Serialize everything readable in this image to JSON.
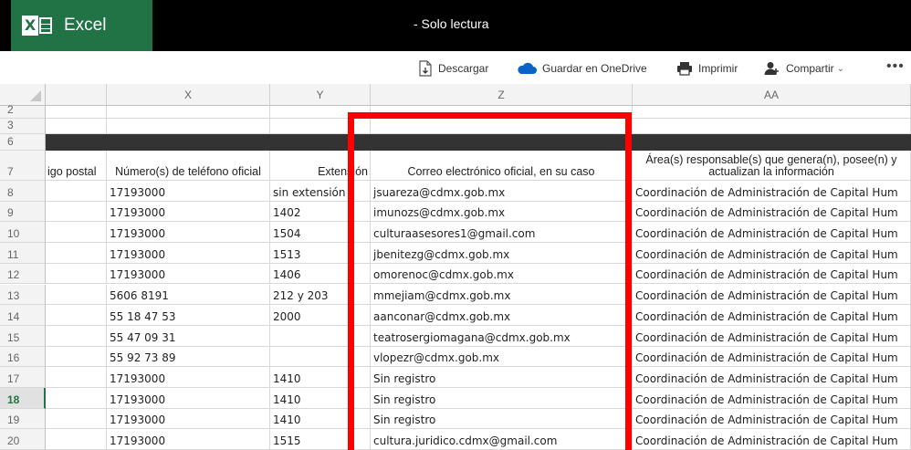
{
  "app": {
    "name": "Excel",
    "document_title": "-   Solo lectura"
  },
  "toolbar": {
    "download": "Descargar",
    "save_onedrive": "Guardar en OneDrive",
    "print": "Imprimir",
    "share": "Compartir",
    "share_chevron": "⌄",
    "more": "•••"
  },
  "columns": [
    "X",
    "Y",
    "Z",
    "AA"
  ],
  "header_row": {
    "row_num": "7",
    "w": "igo postal",
    "x": "Número(s) de teléfono oficial",
    "y": "Extensión",
    "z": "Correo electrónico oficial, en su caso",
    "aa": "Área(s) responsable(s) que genera(n), posee(n) y actualizan la información"
  },
  "rows": [
    {
      "n": "8",
      "x": "17193000",
      "y": "sin extensión",
      "z": "jsuareza@cdmx.gob.mx",
      "aa": "Coordinación de Administración de Capital Hum"
    },
    {
      "n": "9",
      "x": "17193000",
      "y": "1402",
      "z": "imunozs@cdmx.gob.mx",
      "aa": "Coordinación de Administración de Capital Hum"
    },
    {
      "n": "10",
      "x": "17193000",
      "y": "1504",
      "z": "culturaasesores1@gmail.com",
      "aa": "Coordinación de Administración de Capital Hum"
    },
    {
      "n": "11",
      "x": "17193000",
      "y": "1513",
      "z": "jbenitezg@cdmx.gob.mx",
      "aa": "Coordinación de Administración de Capital Hum"
    },
    {
      "n": "12",
      "x": "17193000",
      "y": "1406",
      "z": "omorenoc@cdmx.gob.mx",
      "aa": "Coordinación de Administración de Capital Hum"
    },
    {
      "n": "13",
      "x": "5606 8191",
      "y": "212 y 203",
      "z": "mmejiam@cdmx.gob.mx",
      "aa": "Coordinación de Administración de Capital Hum"
    },
    {
      "n": "14",
      "x": "55 18 47 53",
      "y": "2000",
      "z": "aanconar@cdmx.gob.mx",
      "aa": "Coordinación de Administración de Capital Hum"
    },
    {
      "n": "15",
      "x": "55 47 09 31",
      "y": "",
      "z": "teatrosergiomagana@cdmx.gob.mx",
      "aa": "Coordinación de Administración de Capital Hum"
    },
    {
      "n": "16",
      "x": "55 92 73 89",
      "y": "",
      "z": "vlopezr@cdmx.gob.mx",
      "aa": "Coordinación de Administración de Capital Hum"
    },
    {
      "n": "17",
      "x": "17193000",
      "y": "1410",
      "z": "Sin registro",
      "aa": "Coordinación de Administración de Capital Hum"
    },
    {
      "n": "18",
      "x": "17193000",
      "y": "1410",
      "z": "Sin registro",
      "aa": "Coordinación de Administración de Capital Hum"
    },
    {
      "n": "19",
      "x": "17193000",
      "y": "1410",
      "z": "Sin registro",
      "aa": "Coordinación de Administración de Capital Hum"
    },
    {
      "n": "20",
      "x": "17193000",
      "y": "1515",
      "z": "cultura.juridico.cdmx@gmail.com",
      "aa": "Coordinación de Administración de Capital Hum"
    }
  ],
  "top_rows": [
    "2",
    "3",
    "6"
  ],
  "selected_row": "18",
  "colors": {
    "excel_green": "#217346",
    "highlight": "#ff0000"
  }
}
